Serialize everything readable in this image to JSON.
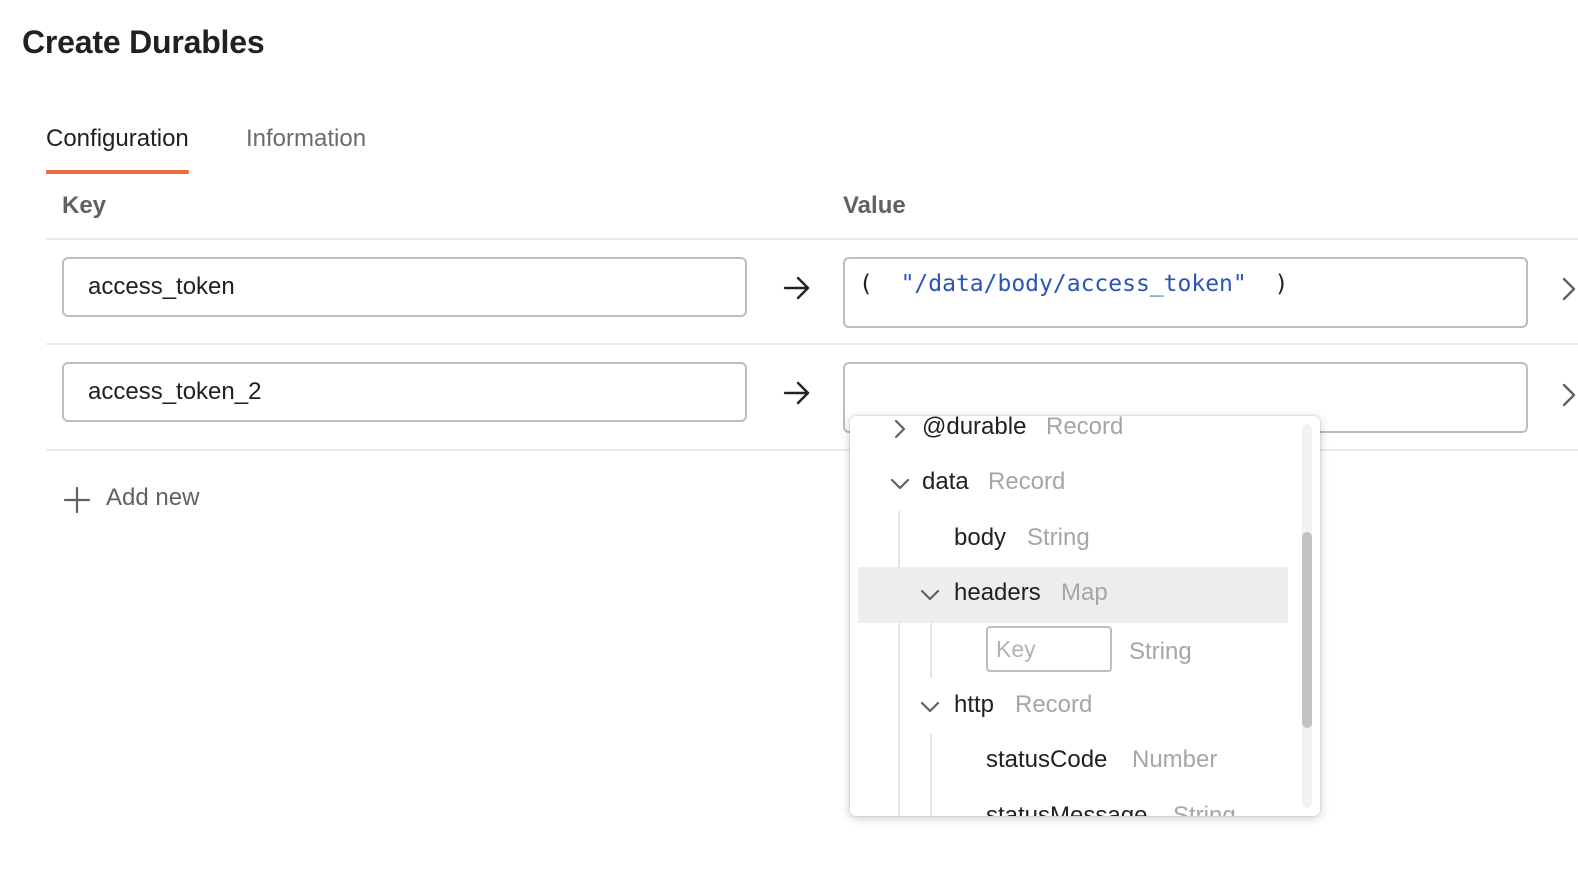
{
  "page": {
    "title": "Create Durables"
  },
  "tabs": [
    {
      "label": "Configuration",
      "active": true
    },
    {
      "label": "Information",
      "active": false
    }
  ],
  "table": {
    "key_header": "Key",
    "value_header": "Value",
    "rows": [
      {
        "key": "access_token",
        "value_open": "(",
        "value_string": "\"/data/body/access_token\"",
        "value_close": ")"
      },
      {
        "key": "access_token_2",
        "value_open": "",
        "value_string": "",
        "value_close": ""
      }
    ],
    "add_new_label": "Add new"
  },
  "dropdown": {
    "items": [
      {
        "name": "@durable",
        "type": "Record",
        "expanded": false
      },
      {
        "name": "data",
        "type": "Record",
        "expanded": true
      },
      {
        "name": "body",
        "type": "String"
      },
      {
        "name": "headers",
        "type": "Map",
        "expanded": true,
        "highlighted": true
      },
      {
        "key_placeholder": "Key",
        "type": "String"
      },
      {
        "name": "http",
        "type": "Record",
        "expanded": true
      },
      {
        "name": "statusCode",
        "type": "Number"
      },
      {
        "name": "statusMessage",
        "type": "String"
      }
    ],
    "scroll": {
      "position_fraction": 0.3,
      "visible_fraction": 0.5
    }
  },
  "colors": {
    "accent": "#ec6c3f",
    "string_literal": "#2a54b8",
    "highlight_row": "#ededed"
  },
  "icons": [
    "arrow-right-icon",
    "chevron-right-icon",
    "chevron-down-icon",
    "plus-icon"
  ]
}
